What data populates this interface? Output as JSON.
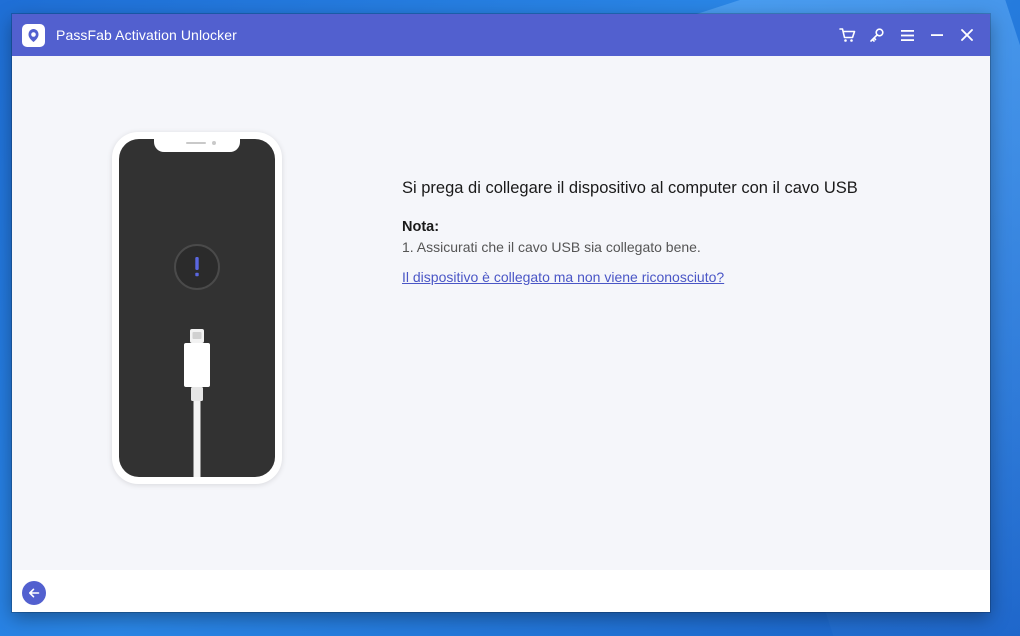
{
  "window": {
    "title": "PassFab Activation Unlocker",
    "accent_color": "#5260cf"
  },
  "titlebar_controls": [
    {
      "name": "cart-icon",
      "label": ""
    },
    {
      "name": "key-icon",
      "label": ""
    },
    {
      "name": "menu-icon",
      "label": ""
    },
    {
      "name": "minimize-icon",
      "label": ""
    },
    {
      "name": "close-icon",
      "label": ""
    }
  ],
  "main": {
    "instruction": "Si prega di collegare il dispositivo al computer con il cavo USB",
    "note_label": "Nota:",
    "note_items": [
      "1. Assicurati che il cavo USB sia collegato bene."
    ],
    "help_link": "Il dispositivo è collegato ma non viene riconosciuto?"
  },
  "illustration": {
    "phone_icon": "exclamation-icon",
    "cable_icon": "usb-cable-icon"
  },
  "footer": {
    "back_icon": "back-arrow-icon"
  }
}
